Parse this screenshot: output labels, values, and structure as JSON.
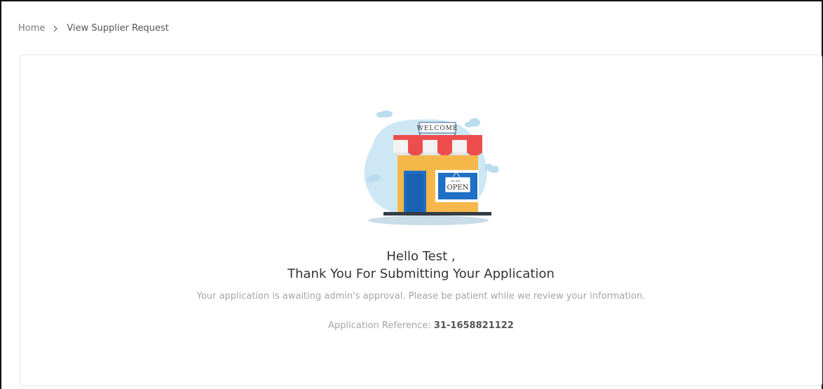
{
  "breadcrumb": {
    "home": "Home",
    "current": "View Supplier Request"
  },
  "illustration": {
    "sign_text": "WELCOME",
    "door_sign_top": "WE ARE",
    "door_sign_text": "OPEN"
  },
  "message": {
    "greeting": "Hello Test ,",
    "title": "Thank You For Submitting Your Application",
    "subtext": "Your application is awaiting admin's approval. Please be patient while we review your information.",
    "reference_label": "Application Reference:",
    "reference_value": "31-1658821122"
  },
  "colors": {
    "awning_red": "#ee4d4d",
    "shop_yellow": "#f7b84b",
    "door_blue": "#1f6fc5",
    "cloud_blue": "#cde8f4"
  }
}
